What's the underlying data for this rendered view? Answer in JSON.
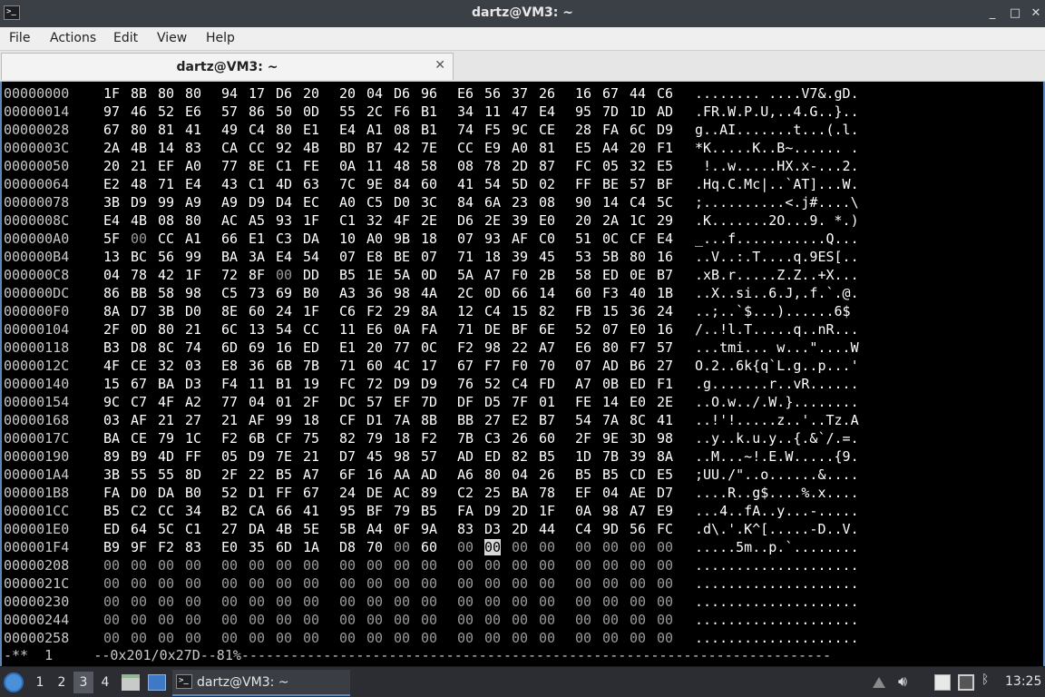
{
  "window": {
    "title": "dartz@VM3: ~",
    "icon": "terminal-icon"
  },
  "menu": [
    "File",
    "Actions",
    "Edit",
    "View",
    "Help"
  ],
  "tab": {
    "label": "dartz@VM3: ~",
    "close": "✕"
  },
  "window_controls": {
    "minimize": "_",
    "maximize": "□",
    "close": "✕"
  },
  "hexdump": {
    "rows": [
      {
        "addr": "00000000",
        "bytes": [
          "1F",
          "8B",
          "80",
          "80",
          "94",
          "17",
          "D6",
          "20",
          "20",
          "04",
          "D6",
          "96",
          "E6",
          "56",
          "37",
          "26",
          "16",
          "67",
          "44",
          "C6"
        ],
        "ascii": "........ ....V7&.gD."
      },
      {
        "addr": "00000014",
        "bytes": [
          "97",
          "46",
          "52",
          "E6",
          "57",
          "86",
          "50",
          "0D",
          "55",
          "2C",
          "F6",
          "B1",
          "34",
          "11",
          "47",
          "E4",
          "95",
          "7D",
          "1D",
          "AD"
        ],
        "ascii": ".FR.W.P.U,..4.G..}.."
      },
      {
        "addr": "00000028",
        "bytes": [
          "67",
          "80",
          "81",
          "41",
          "49",
          "C4",
          "80",
          "E1",
          "E4",
          "A1",
          "08",
          "B1",
          "74",
          "F5",
          "9C",
          "CE",
          "28",
          "FA",
          "6C",
          "D9"
        ],
        "ascii": "g..AI.......t...(.l."
      },
      {
        "addr": "0000003C",
        "bytes": [
          "2A",
          "4B",
          "14",
          "83",
          "CA",
          "CC",
          "92",
          "4B",
          "BD",
          "B7",
          "42",
          "7E",
          "CC",
          "E9",
          "A0",
          "81",
          "E5",
          "A4",
          "20",
          "F1"
        ],
        "ascii": "*K.....K..B~...... ."
      },
      {
        "addr": "00000050",
        "bytes": [
          "20",
          "21",
          "EF",
          "A0",
          "77",
          "8E",
          "C1",
          "FE",
          "0A",
          "11",
          "48",
          "58",
          "08",
          "78",
          "2D",
          "87",
          "FC",
          "05",
          "32",
          "E5"
        ],
        "ascii": " !..w.....HX.x-...2."
      },
      {
        "addr": "00000064",
        "bytes": [
          "E2",
          "48",
          "71",
          "E4",
          "43",
          "C1",
          "4D",
          "63",
          "7C",
          "9E",
          "84",
          "60",
          "41",
          "54",
          "5D",
          "02",
          "FF",
          "BE",
          "57",
          "BF"
        ],
        "ascii": ".Hq.C.Mc|..`AT]...W."
      },
      {
        "addr": "00000078",
        "bytes": [
          "3B",
          "D9",
          "99",
          "A9",
          "A9",
          "D9",
          "D4",
          "EC",
          "A0",
          "C5",
          "D0",
          "3C",
          "84",
          "6A",
          "23",
          "08",
          "90",
          "14",
          "C4",
          "5C"
        ],
        "ascii": ";..........<.j#....\\"
      },
      {
        "addr": "0000008C",
        "bytes": [
          "E4",
          "4B",
          "08",
          "80",
          "AC",
          "A5",
          "93",
          "1F",
          "C1",
          "32",
          "4F",
          "2E",
          "D6",
          "2E",
          "39",
          "E0",
          "20",
          "2A",
          "1C",
          "29"
        ],
        "ascii": ".K.......2O...9. *.)"
      },
      {
        "addr": "000000A0",
        "bytes": [
          "5F",
          "00",
          "CC",
          "A1",
          "66",
          "E1",
          "C3",
          "DA",
          "10",
          "A0",
          "9B",
          "18",
          "07",
          "93",
          "AF",
          "C0",
          "51",
          "0C",
          "CF",
          "E4"
        ],
        "ascii": "_...f...........Q..."
      },
      {
        "addr": "000000B4",
        "bytes": [
          "13",
          "BC",
          "56",
          "99",
          "BA",
          "3A",
          "E4",
          "54",
          "07",
          "E8",
          "BE",
          "07",
          "71",
          "18",
          "39",
          "45",
          "53",
          "5B",
          "80",
          "16"
        ],
        "ascii": "..V..:.T....q.9ES[.."
      },
      {
        "addr": "000000C8",
        "bytes": [
          "04",
          "78",
          "42",
          "1F",
          "72",
          "8F",
          "00",
          "DD",
          "B5",
          "1E",
          "5A",
          "0D",
          "5A",
          "A7",
          "F0",
          "2B",
          "58",
          "ED",
          "0E",
          "B7"
        ],
        "ascii": ".xB.r.....Z.Z..+X..."
      },
      {
        "addr": "000000DC",
        "bytes": [
          "86",
          "BB",
          "58",
          "98",
          "C5",
          "73",
          "69",
          "B0",
          "A3",
          "36",
          "98",
          "4A",
          "2C",
          "0D",
          "66",
          "14",
          "60",
          "F3",
          "40",
          "1B"
        ],
        "ascii": "..X..si..6.J,.f.`.@."
      },
      {
        "addr": "000000F0",
        "bytes": [
          "8A",
          "D7",
          "3B",
          "D0",
          "8E",
          "60",
          "24",
          "1F",
          "C6",
          "F2",
          "29",
          "8A",
          "12",
          "C4",
          "15",
          "82",
          "FB",
          "15",
          "36",
          "24"
        ],
        "ascii": "..;..`$...)......6$"
      },
      {
        "addr": "00000104",
        "bytes": [
          "2F",
          "0D",
          "80",
          "21",
          "6C",
          "13",
          "54",
          "CC",
          "11",
          "E6",
          "0A",
          "FA",
          "71",
          "DE",
          "BF",
          "6E",
          "52",
          "07",
          "E0",
          "16"
        ],
        "ascii": "/..!l.T.....q..nR..."
      },
      {
        "addr": "00000118",
        "bytes": [
          "B3",
          "D8",
          "8C",
          "74",
          "6D",
          "69",
          "16",
          "ED",
          "E1",
          "20",
          "77",
          "0C",
          "F2",
          "98",
          "22",
          "A7",
          "E6",
          "80",
          "F7",
          "57"
        ],
        "ascii": "...tmi... w...\"....W"
      },
      {
        "addr": "0000012C",
        "bytes": [
          "4F",
          "CE",
          "32",
          "03",
          "E8",
          "36",
          "6B",
          "7B",
          "71",
          "60",
          "4C",
          "17",
          "67",
          "F7",
          "F0",
          "70",
          "07",
          "AD",
          "B6",
          "27"
        ],
        "ascii": "O.2..6k{q`L.g..p...'"
      },
      {
        "addr": "00000140",
        "bytes": [
          "15",
          "67",
          "BA",
          "D3",
          "F4",
          "11",
          "B1",
          "19",
          "FC",
          "72",
          "D9",
          "D9",
          "76",
          "52",
          "C4",
          "FD",
          "A7",
          "0B",
          "ED",
          "F1"
        ],
        "ascii": ".g.......r..vR......"
      },
      {
        "addr": "00000154",
        "bytes": [
          "9C",
          "C7",
          "4F",
          "A2",
          "77",
          "04",
          "01",
          "2F",
          "DC",
          "57",
          "EF",
          "7D",
          "DF",
          "D5",
          "7F",
          "01",
          "FE",
          "14",
          "E0",
          "2E"
        ],
        "ascii": "..O.w../.W.}........"
      },
      {
        "addr": "00000168",
        "bytes": [
          "03",
          "AF",
          "21",
          "27",
          "21",
          "AF",
          "99",
          "18",
          "CF",
          "D1",
          "7A",
          "8B",
          "BB",
          "27",
          "E2",
          "B7",
          "54",
          "7A",
          "8C",
          "41"
        ],
        "ascii": "..!'!.....z..'..Tz.A"
      },
      {
        "addr": "0000017C",
        "bytes": [
          "BA",
          "CE",
          "79",
          "1C",
          "F2",
          "6B",
          "CF",
          "75",
          "82",
          "79",
          "18",
          "F2",
          "7B",
          "C3",
          "26",
          "60",
          "2F",
          "9E",
          "3D",
          "98"
        ],
        "ascii": "..y..k.u.y..{.&`/.=."
      },
      {
        "addr": "00000190",
        "bytes": [
          "89",
          "B9",
          "4D",
          "FF",
          "05",
          "D9",
          "7E",
          "21",
          "D7",
          "45",
          "98",
          "57",
          "AD",
          "ED",
          "82",
          "B5",
          "1D",
          "7B",
          "39",
          "8A"
        ],
        "ascii": "..M...~!.E.W.....{9."
      },
      {
        "addr": "000001A4",
        "bytes": [
          "3B",
          "55",
          "55",
          "8D",
          "2F",
          "22",
          "B5",
          "A7",
          "6F",
          "16",
          "AA",
          "AD",
          "A6",
          "80",
          "04",
          "26",
          "B5",
          "B5",
          "CD",
          "E5"
        ],
        "ascii": ";UU./\"..o......&...."
      },
      {
        "addr": "000001B8",
        "bytes": [
          "FA",
          "D0",
          "DA",
          "B0",
          "52",
          "D1",
          "FF",
          "67",
          "24",
          "DE",
          "AC",
          "89",
          "C2",
          "25",
          "BA",
          "78",
          "EF",
          "04",
          "AE",
          "D7"
        ],
        "ascii": "....R..g$....%.x...."
      },
      {
        "addr": "000001CC",
        "bytes": [
          "B5",
          "C2",
          "CC",
          "34",
          "B2",
          "CA",
          "66",
          "41",
          "95",
          "BF",
          "79",
          "B5",
          "FA",
          "D9",
          "2D",
          "1F",
          "0A",
          "98",
          "A7",
          "E9"
        ],
        "ascii": "...4..fA..y...-....."
      },
      {
        "addr": "000001E0",
        "bytes": [
          "ED",
          "64",
          "5C",
          "C1",
          "27",
          "DA",
          "4B",
          "5E",
          "5B",
          "A4",
          "0F",
          "9A",
          "83",
          "D3",
          "2D",
          "44",
          "C4",
          "9D",
          "56",
          "FC"
        ],
        "ascii": ".d\\.'.K^[.....-D..V."
      },
      {
        "addr": "000001F4",
        "bytes": [
          "B9",
          "9F",
          "F2",
          "83",
          "E0",
          "35",
          "6D",
          "1A",
          "D8",
          "70",
          "00",
          "60",
          "00",
          "00",
          "00",
          "00",
          "00",
          "00",
          "00",
          "00"
        ],
        "ascii": ".....5m..p.`........"
      },
      {
        "addr": "00000208",
        "bytes": [
          "00",
          "00",
          "00",
          "00",
          "00",
          "00",
          "00",
          "00",
          "00",
          "00",
          "00",
          "00",
          "00",
          "00",
          "00",
          "00",
          "00",
          "00",
          "00",
          "00"
        ],
        "ascii": "...................."
      },
      {
        "addr": "0000021C",
        "bytes": [
          "00",
          "00",
          "00",
          "00",
          "00",
          "00",
          "00",
          "00",
          "00",
          "00",
          "00",
          "00",
          "00",
          "00",
          "00",
          "00",
          "00",
          "00",
          "00",
          "00"
        ],
        "ascii": "...................."
      },
      {
        "addr": "00000230",
        "bytes": [
          "00",
          "00",
          "00",
          "00",
          "00",
          "00",
          "00",
          "00",
          "00",
          "00",
          "00",
          "00",
          "00",
          "00",
          "00",
          "00",
          "00",
          "00",
          "00",
          "00"
        ],
        "ascii": "...................."
      },
      {
        "addr": "00000244",
        "bytes": [
          "00",
          "00",
          "00",
          "00",
          "00",
          "00",
          "00",
          "00",
          "00",
          "00",
          "00",
          "00",
          "00",
          "00",
          "00",
          "00",
          "00",
          "00",
          "00",
          "00"
        ],
        "ascii": "...................."
      },
      {
        "addr": "00000258",
        "bytes": [
          "00",
          "00",
          "00",
          "00",
          "00",
          "00",
          "00",
          "00",
          "00",
          "00",
          "00",
          "00",
          "00",
          "00",
          "00",
          "00",
          "00",
          "00",
          "00",
          "00"
        ],
        "ascii": "...................."
      }
    ],
    "cursor": {
      "row": 25,
      "byte": 13
    },
    "status": "-**  1     --0x201/0x27D--81%------------------------------------------------------------------------"
  },
  "taskbar": {
    "workspaces": [
      "1",
      "2",
      "3",
      "4"
    ],
    "active_workspace": "3",
    "window_label": "dartz@VM3: ~",
    "clock": "13:25"
  }
}
